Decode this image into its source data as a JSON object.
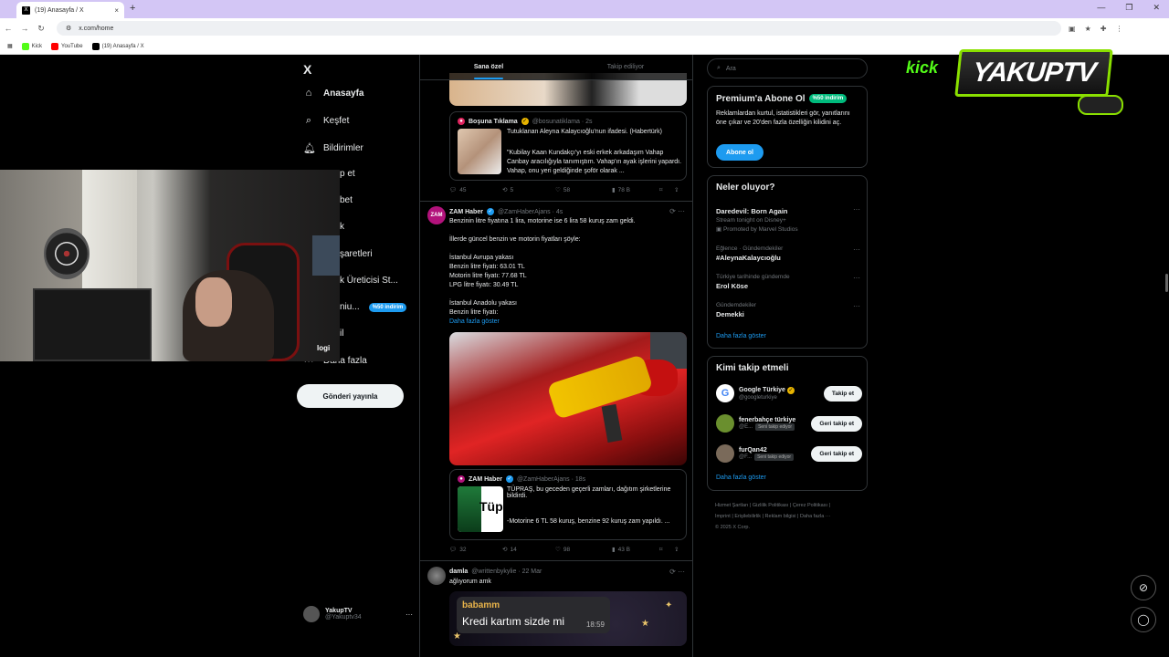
{
  "browser": {
    "tab_title": "(19) Anasayfa / X",
    "tab_close": "×",
    "new_tab": "+",
    "url": "x.com/home",
    "bookmarks": [
      {
        "label": "Kick",
        "color": "#53fc18"
      },
      {
        "label": "YouTube",
        "color": "#ff0000"
      },
      {
        "label": "(19) Anasayfa / X",
        "color": "#000000"
      }
    ]
  },
  "nav": {
    "brand": "X",
    "items": [
      {
        "label": "Anasayfa",
        "icon": "home-icon"
      },
      {
        "label": "Keşfet",
        "icon": "search-icon"
      },
      {
        "label": "Bildirimler",
        "icon": "bell-icon"
      },
      {
        "label": "p et",
        "icon": ""
      },
      {
        "label": "bet",
        "icon": ""
      },
      {
        "label": "k",
        "icon": ""
      },
      {
        "label": "şaretleri",
        "icon": ""
      },
      {
        "label": "k Üreticisi St...",
        "icon": ""
      },
      {
        "label": "niu...",
        "icon": ""
      },
      {
        "label": "il",
        "icon": ""
      },
      {
        "label": "Daha fazla",
        "icon": "more-icon"
      }
    ],
    "premium_badge": "%50 indirim",
    "post_button": "Gönderi yayınla",
    "profile": {
      "name": "YakupTV",
      "handle": "@Yakuptv34",
      "more": "···"
    },
    "overlay_text": "logi"
  },
  "feed": {
    "tabs": [
      "Sana özel",
      "Takip ediliyor"
    ],
    "quote1": {
      "name": "Boşuna Tıklama",
      "handle": "@bosunatiklama · 2s",
      "title": "Tutuklanan Aleyna Kalaycıoğlu'nun ifadesi. (Habertürk)",
      "body": "\"Kubilay Kaan Kundakçı'yı eski erkek arkadaşım Vahap Canbay aracılığıyla tanımıştım. Vahap'ın ayak işlerini yapardı. Vahap, onu yeri geldiğinde şoför olarak ..."
    },
    "actions1": {
      "replies": "45",
      "reposts": "5",
      "likes": "58",
      "views": "78 B"
    },
    "tweet2": {
      "avatar_text": "ZAM",
      "name": "ZAM Haber",
      "handle": "@ZamHaberAjans · 4s",
      "lines": [
        "Benzinin litre fiyatına 1 lira, motorine ise 6 lira 58 kuruş zam geldi.",
        "",
        "İllerde güncel benzin ve motorin fiyatları şöyle:",
        "",
        "İstanbul Avrupa yakası",
        "Benzin litre fiyatı: 63.01 TL",
        "Motorin litre fiyatı: 77.68 TL",
        "LPG litre fiyatı: 30.49 TL",
        "",
        "İstanbul Anadolu yakası",
        "Benzin litre fiyatı:"
      ],
      "show_more": "Daha fazla göster"
    },
    "quote2": {
      "name": "ZAM Haber",
      "handle": "@ZamHaberAjans · 18s",
      "title": "TÜPRAŞ, bu geceden geçerli zamları, dağıtım şirketlerine bildirdi.",
      "body": "-Motorine 6 TL 58 kuruş, benzine 92 kuruş zam yapıldı. ...",
      "thumb_text": "Tüp"
    },
    "actions2": {
      "replies": "32",
      "reposts": "14",
      "likes": "98",
      "views": "43 B"
    },
    "tweet3": {
      "name": "damla",
      "handle": "@writtenbykylie · 22 Mar",
      "text": "ağlıyorum amk",
      "chat_name": "babamm",
      "chat_msg": "Kredi kartım sizde mi",
      "chat_time": "18:59"
    }
  },
  "right": {
    "search_placeholder": "Ara",
    "premium": {
      "title": "Premium'a Abone Ol",
      "badge": "%50 indirim",
      "text": "Reklamlardan kurtul, istatistikleri gör, yanıtlarını öne çıkar ve 20'den fazla özelliğin kilidini aç.",
      "button": "Abone ol"
    },
    "trends_title": "Neler oluyor?",
    "trends": [
      {
        "context": "",
        "title": "Daredevil: Born Again",
        "sub": "Stream tonight on Disney+",
        "promo": "Promoted by Marvel Studios"
      },
      {
        "context": "Eğlence · Gündemdekiler",
        "title": "#AleynaKalaycıoğlu",
        "sub": "",
        "promo": ""
      },
      {
        "context": "Türkiye tarihinde gündemde",
        "title": "Erol Köse",
        "sub": "",
        "promo": ""
      },
      {
        "context": "Gündemdekiler",
        "title": "Demekki",
        "sub": "",
        "promo": ""
      }
    ],
    "trends_more": "Daha fazla göster",
    "who_title": "Kimi takip etmeli",
    "who": [
      {
        "name": "Google Türkiye",
        "handle": "@googleturkiye",
        "badge": "",
        "button": "Takip et",
        "color": "#ffffff"
      },
      {
        "name": "fenerbahçe türkiye",
        "handle": "@E...",
        "badge": "Seni takip ediyor",
        "button": "Geri takip et",
        "color": "#6a8f2e"
      },
      {
        "name": "furQan42",
        "handle": "@F...",
        "badge": "Seni takip ediyor",
        "button": "Geri takip et",
        "color": "#7a6a5a"
      }
    ],
    "who_more": "Daha fazla göster",
    "footer": [
      "Hizmet Şartları",
      "Gizlilik Politikası",
      "Çerez Politikası",
      "Imprint",
      "Erişilebilirlik",
      "Reklam bilgisi",
      "Daha fazla ···",
      "© 2025 X Corp."
    ]
  },
  "overlay": {
    "kick": "kick",
    "brand": "YAKUPTV"
  }
}
